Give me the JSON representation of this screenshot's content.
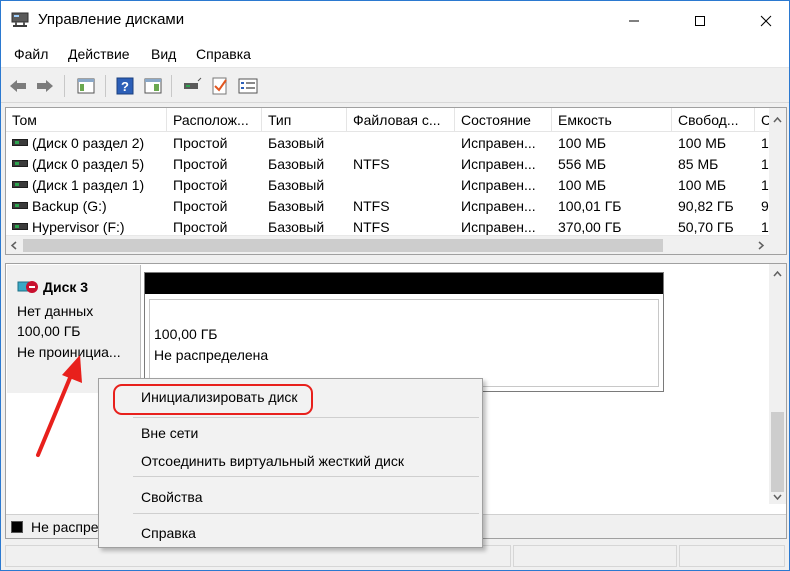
{
  "window": {
    "title": "Управление дисками",
    "controls": {
      "minimize": "minimize",
      "maximize": "maximize",
      "close": "close"
    }
  },
  "menu": [
    "Файл",
    "Действие",
    "Вид",
    "Справка"
  ],
  "toolbar": {
    "icons": [
      "back-icon",
      "forward-icon",
      "console-tree-icon",
      "help-icon",
      "properties-icon",
      "connect-icon",
      "checkmark-icon",
      "list-icon"
    ]
  },
  "volume_list": {
    "columns": [
      "Том",
      "Располож...",
      "Тип",
      "Файловая с...",
      "Состояние",
      "Емкость",
      "Свобод...",
      "С"
    ],
    "rows": [
      [
        "(Диск 0 раздел 2)",
        "Простой",
        "Базовый",
        "",
        "Исправен...",
        "100 МБ",
        "100 МБ",
        "1"
      ],
      [
        "(Диск 0 раздел 5)",
        "Простой",
        "Базовый",
        "NTFS",
        "Исправен...",
        "556 МБ",
        "85 МБ",
        "1"
      ],
      [
        "(Диск 1 раздел 1)",
        "Простой",
        "Базовый",
        "",
        "Исправен...",
        "100 МБ",
        "100 МБ",
        "1"
      ],
      [
        "Backup (G:)",
        "Простой",
        "Базовый",
        "NTFS",
        "Исправен...",
        "100,01 ГБ",
        "90,82 ГБ",
        "9"
      ],
      [
        "Hypervisor (F:)",
        "Простой",
        "Базовый",
        "NTFS",
        "Исправен...",
        "370,00 ГБ",
        "50,70 ГБ",
        "1"
      ]
    ]
  },
  "disk": {
    "name": "Диск 3",
    "type": "Нет данных",
    "size": "100,00 ГБ",
    "state": "Не проинициа...",
    "partition": {
      "size": "100,00 ГБ",
      "status": "Не распределена"
    }
  },
  "legend": {
    "label": "Не распре"
  },
  "context_menu": {
    "items": [
      "Инициализировать диск",
      "Вне сети",
      "Отсоединить виртуальный жесткий диск",
      "Свойства",
      "Справка"
    ]
  },
  "colors": {
    "highlight": "#e8201c",
    "unallocated": "#000000",
    "accent": "#2b79d0"
  }
}
